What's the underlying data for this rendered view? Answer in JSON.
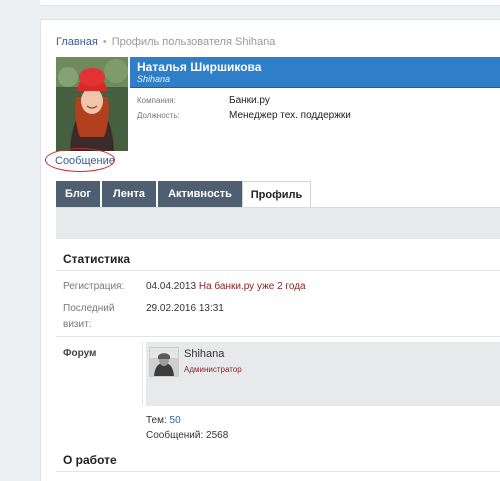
{
  "breadcrumb": {
    "home": "Главная",
    "separator": "•",
    "current": "Профиль пользователя Shihana"
  },
  "profile": {
    "full_name": "Наталья Ширшикова",
    "username": "Shihana",
    "fields": [
      {
        "label": "Компания:",
        "value": "Банки.ру"
      },
      {
        "label": "Должность:",
        "value": "Менеджер тех. поддержки"
      }
    ],
    "message_link": "Сообщение"
  },
  "tabs": [
    {
      "label": "Блог",
      "active": false
    },
    {
      "label": "Лента",
      "active": false
    },
    {
      "label": "Активность",
      "active": false
    },
    {
      "label": "Профиль",
      "active": true
    }
  ],
  "statistics": {
    "title": "Статистика",
    "registration_label": "Регистрация:",
    "registration_date": "04.04.2013",
    "registration_note": "На банки.ру уже 2 года",
    "last_visit_label_1": "Последний",
    "last_visit_label_2": "визит:",
    "last_visit_value": "29.02.2016 13:31"
  },
  "forum": {
    "label": "Форум",
    "username": "Shihana",
    "role": "Администратор",
    "topics_label": "Тем:",
    "topics_count": "50",
    "posts_label": "Сообщений:",
    "posts_count": "2568"
  },
  "about": {
    "title": "О работе"
  },
  "colors": {
    "header_blue": "#2e7fc8",
    "tab_dark": "#4f5f72",
    "link": "#365f8c",
    "accent_red": "#8b1f1f",
    "annotation_red": "#c42a2a"
  }
}
